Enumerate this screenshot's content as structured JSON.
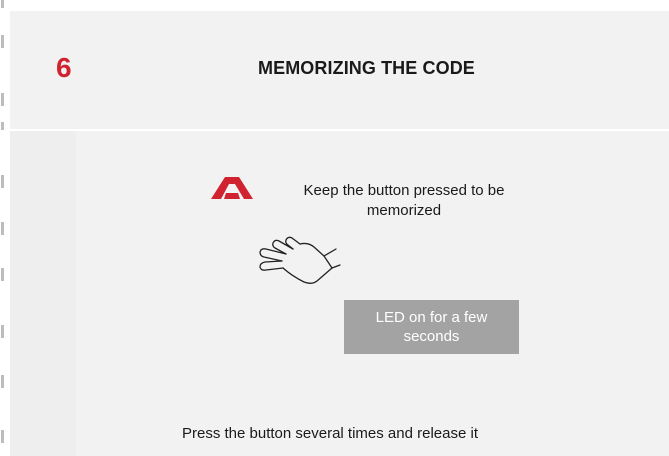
{
  "step": {
    "number": "6",
    "title": "MEMORIZING THE CODE"
  },
  "illustration": {
    "logo_icon": "brand-a-logo",
    "hand_icon": "pressing-hand-icon",
    "instruction": "Keep the button pressed to be memorized",
    "led_note": "LED on for a few seconds"
  },
  "footer": {
    "instruction": "Press the button several times and release it"
  },
  "colors": {
    "accent_red": "#d0222f",
    "led_box_gray": "#a3a3a3",
    "panel_background": "#f2f2f2"
  }
}
